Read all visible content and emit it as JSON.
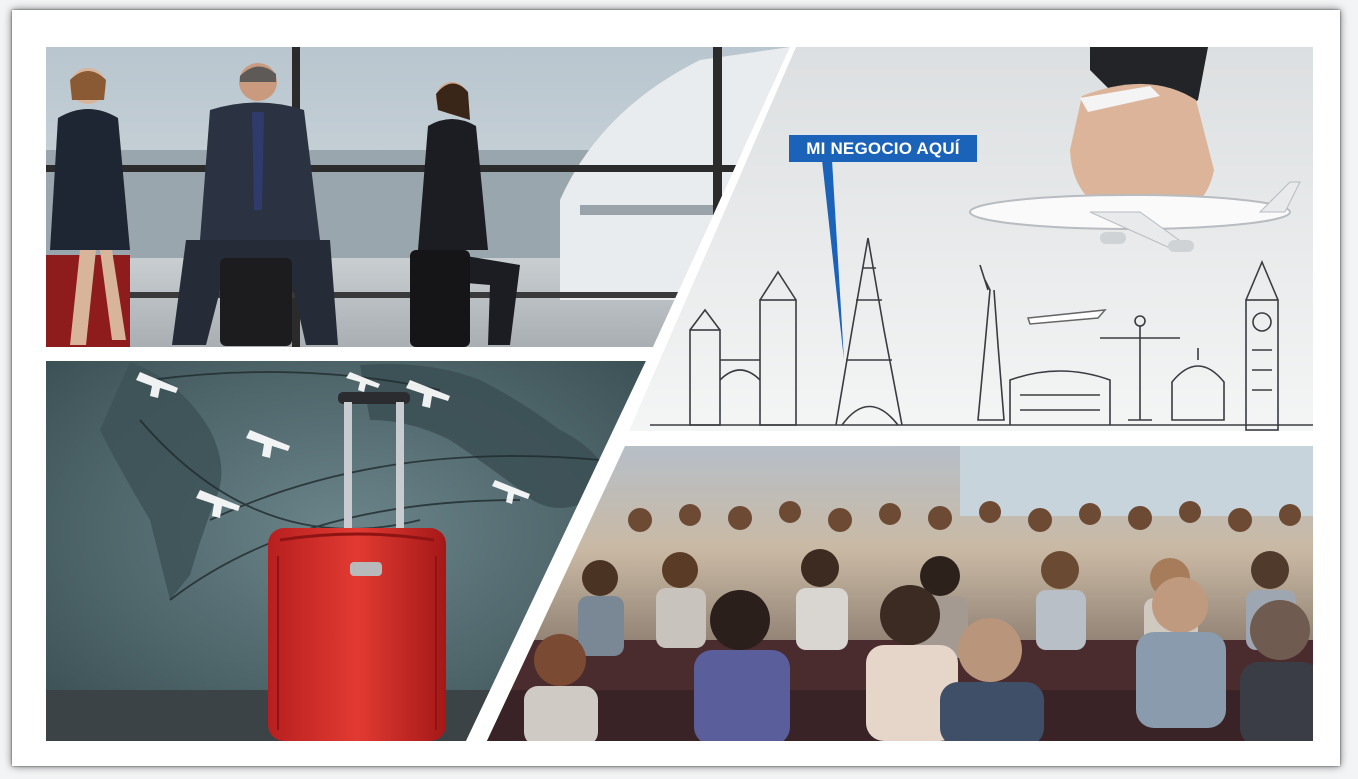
{
  "collage": {
    "panels": [
      {
        "name": "airport-lounge-travelers",
        "description_icon": "business-travelers-photo"
      },
      {
        "name": "world-landmarks-sketch",
        "description_icon": "landmarks-illustration"
      },
      {
        "name": "red-suitcase-flight-map",
        "description_icon": "suitcase-photo"
      },
      {
        "name": "conference-audience",
        "description_icon": "audience-photo"
      }
    ],
    "callout_text": "MI NEGOCIO AQUÍ",
    "colors": {
      "callout_blue": "#1a63b8",
      "suitcase_red": "#d42a2a",
      "frame_white": "#ffffff",
      "wall_teal": "#4e6a70"
    }
  }
}
